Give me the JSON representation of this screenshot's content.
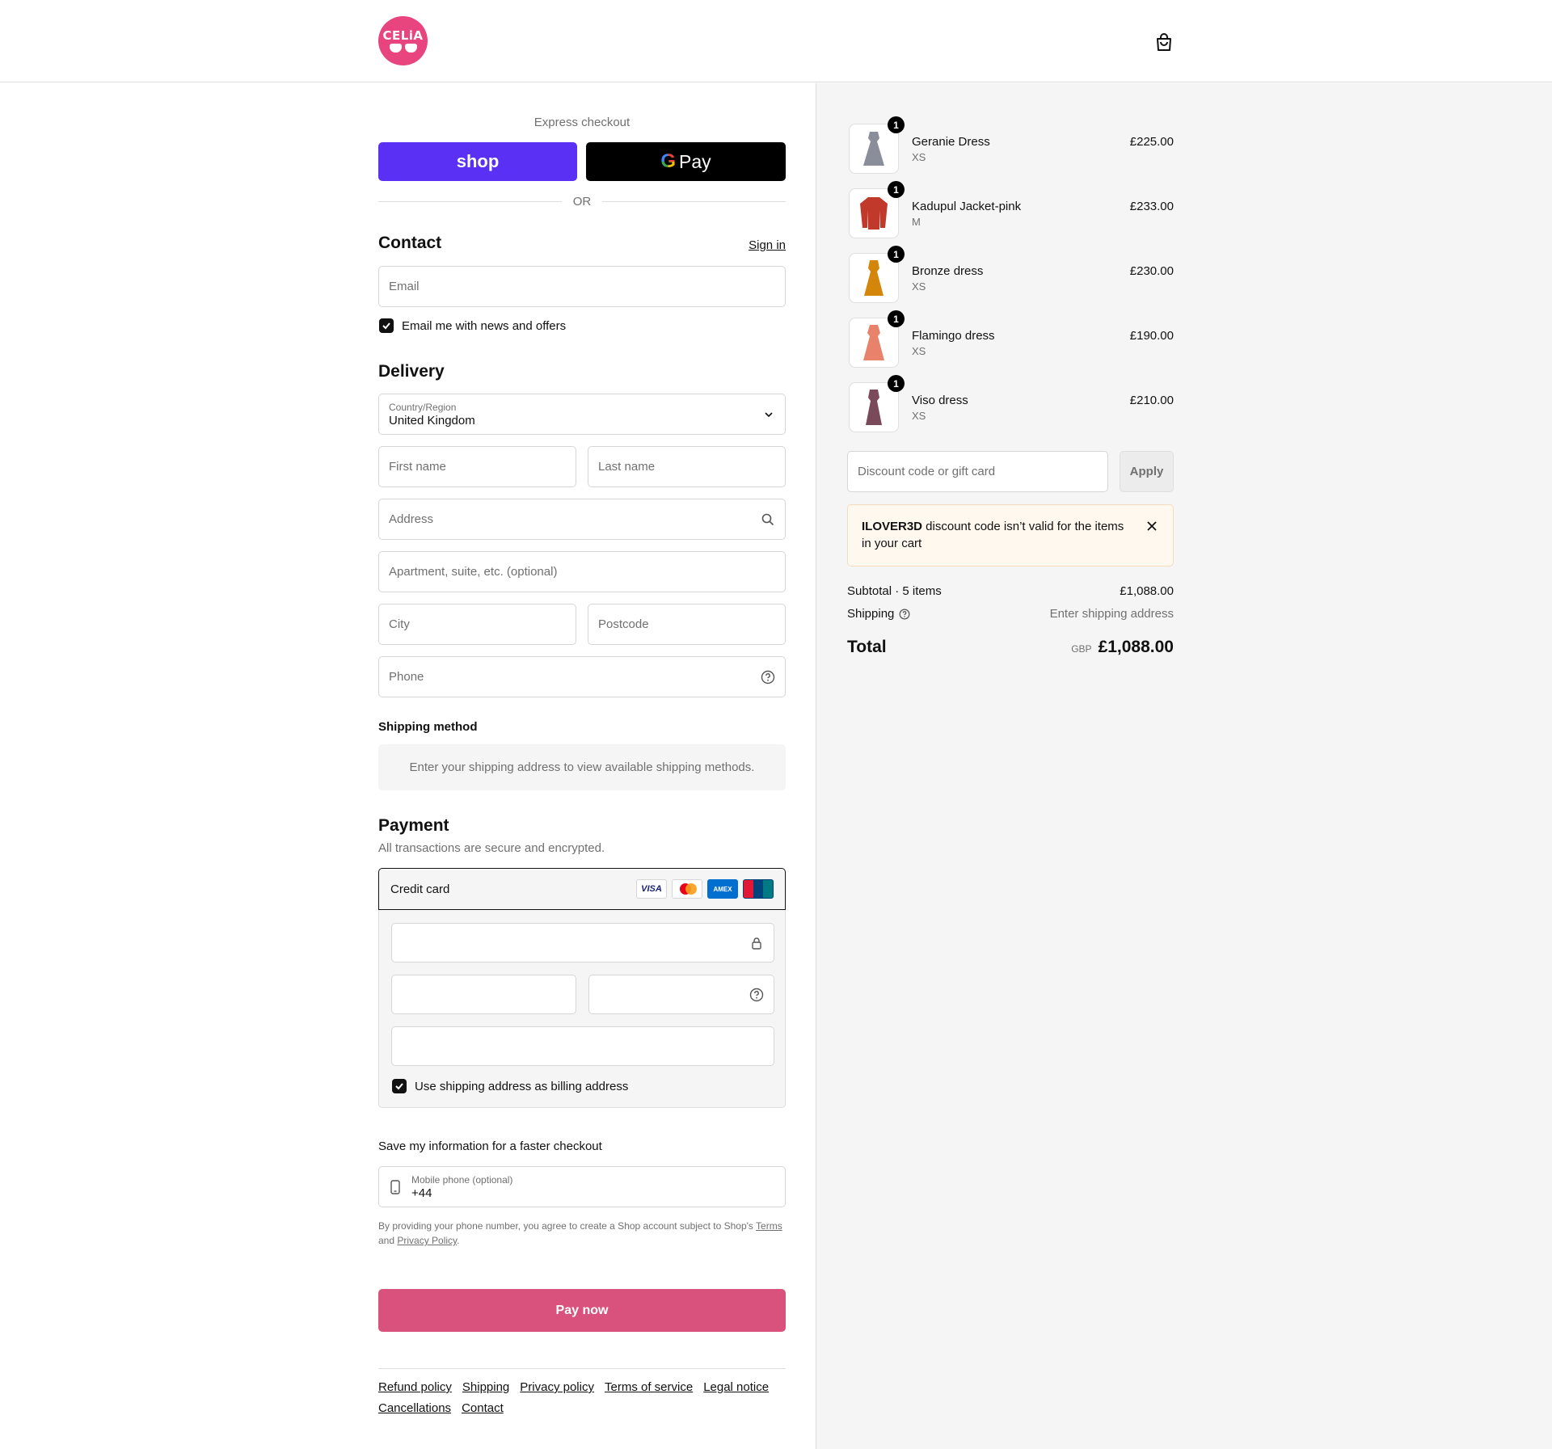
{
  "header": {
    "logo_text": "CELiA",
    "cart_icon": "shopping-bag-icon"
  },
  "express": {
    "label": "Express checkout",
    "shop_label": "shop",
    "gpay_g": "G",
    "gpay_label": "Pay",
    "or_label": "OR"
  },
  "contact": {
    "title": "Contact",
    "sign_in": "Sign in",
    "email_placeholder": "Email",
    "news_label": "Email me with news and offers"
  },
  "delivery": {
    "title": "Delivery",
    "country_label": "Country/Region",
    "country_value": "United Kingdom",
    "first_name": "First name",
    "last_name": "Last name",
    "address": "Address",
    "apartment": "Apartment, suite, etc. (optional)",
    "city": "City",
    "postcode": "Postcode",
    "phone": "Phone"
  },
  "shipping_method": {
    "title": "Shipping method",
    "notice": "Enter your shipping address to view available shipping methods."
  },
  "payment": {
    "title": "Payment",
    "subtext": "All transactions are secure and encrypted.",
    "method": "Credit card",
    "cards": [
      "VISA",
      "Mastercard",
      "AMEX",
      "UnionPay"
    ],
    "billing_label": "Use shipping address as billing address"
  },
  "save_info": {
    "label": "Save my information for a faster checkout",
    "phone_label": "Mobile phone (optional)",
    "phone_value": "+44",
    "disclaimer_pre": "By providing your phone number, you agree to create a Shop account subject to Shop's ",
    "terms": "Terms",
    "and": " and ",
    "privacy": "Privacy Policy",
    "period": "."
  },
  "pay_button": "Pay now",
  "footer_links": [
    "Refund policy",
    "Shipping",
    "Privacy policy",
    "Terms of service",
    "Legal notice",
    "Cancellations",
    "Contact"
  ],
  "summary": {
    "items": [
      {
        "name": "Geranie Dress",
        "variant": "XS",
        "price": "£225.00",
        "qty": "1",
        "color": "#8a8d9a"
      },
      {
        "name": "Kadupul Jacket-pink",
        "variant": "M",
        "price": "£233.00",
        "qty": "1",
        "color": "#c0392b"
      },
      {
        "name": "Bronze dress",
        "variant": "XS",
        "price": "£230.00",
        "qty": "1",
        "color": "#d4860b"
      },
      {
        "name": "Flamingo dress",
        "variant": "XS",
        "price": "£190.00",
        "qty": "1",
        "color": "#e8826a"
      },
      {
        "name": "Viso dress",
        "variant": "XS",
        "price": "£210.00",
        "qty": "1",
        "color": "#7a4a5a"
      }
    ],
    "discount_placeholder": "Discount code or gift card",
    "apply": "Apply",
    "alert_code": "ILOVER3D",
    "alert_text": " discount code isn’t valid for the items in your cart",
    "subtotal_label": "Subtotal · 5 items",
    "subtotal_value": "£1,088.00",
    "shipping_label": "Shipping",
    "shipping_value": "Enter shipping address",
    "total_label": "Total",
    "currency": "GBP",
    "total_value": "£1,088.00"
  }
}
